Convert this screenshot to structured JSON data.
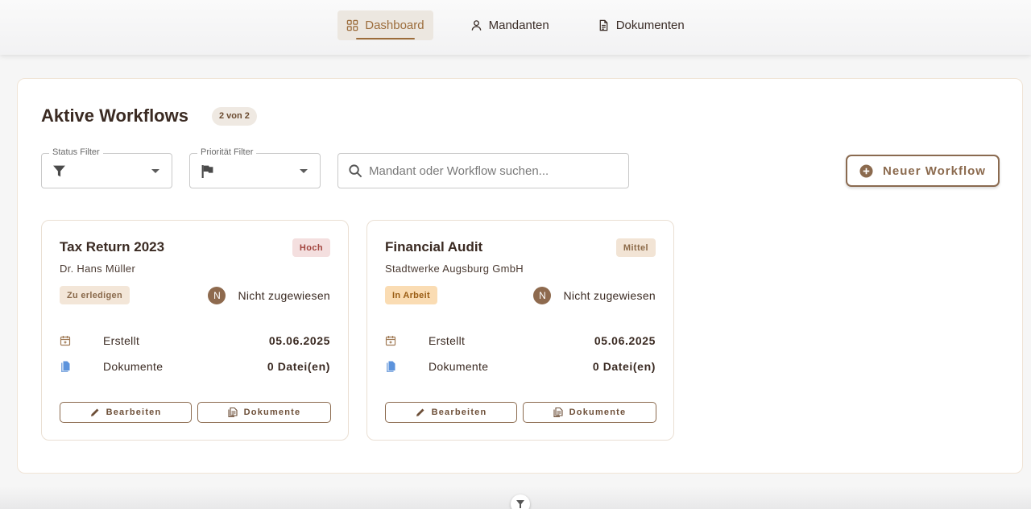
{
  "nav": {
    "items": [
      {
        "label": "Dashboard",
        "icon": "dashboard-icon",
        "active": true
      },
      {
        "label": "Mandanten",
        "icon": "person-icon",
        "active": false
      },
      {
        "label": "Dokumenten",
        "icon": "document-icon",
        "active": false
      }
    ]
  },
  "main": {
    "title": "Aktive Workflows",
    "count_badge": "2 von 2",
    "filters": {
      "status_label": "Status Filter",
      "priority_label": "Priorität Filter"
    },
    "search": {
      "placeholder": "Mandant oder Workflow suchen...",
      "value": ""
    },
    "new_button_label": "Neuer Workflow",
    "cards": [
      {
        "title": "Tax Return 2023",
        "client": "Dr. Hans Müller",
        "priority": "Hoch",
        "status": "Zu erledigen",
        "avatar_initial": "N",
        "assignee": "Nicht zugewiesen",
        "created_label": "Erstellt",
        "created_value": "05.06.2025",
        "docs_label": "Dokumente",
        "docs_value": "0 Datei(en)",
        "edit_label": "Bearbeiten",
        "docs_button_label": "Dokumente"
      },
      {
        "title": "Financial Audit",
        "client": "Stadtwerke Augsburg GmbH",
        "priority": "Mittel",
        "status": "In Arbeit",
        "avatar_initial": "N",
        "assignee": "Nicht zugewiesen",
        "created_label": "Erstellt",
        "created_value": "05.06.2025",
        "docs_label": "Dokumente",
        "docs_value": "0 Datei(en)",
        "edit_label": "Bearbeiten",
        "docs_button_label": "Dokumente"
      }
    ]
  },
  "colors": {
    "accent": "#9c6d3c",
    "priority_high_bg": "#f4dfdf",
    "priority_high_text": "#a2443e",
    "status_in_progress_bg": "#fadcb3"
  }
}
